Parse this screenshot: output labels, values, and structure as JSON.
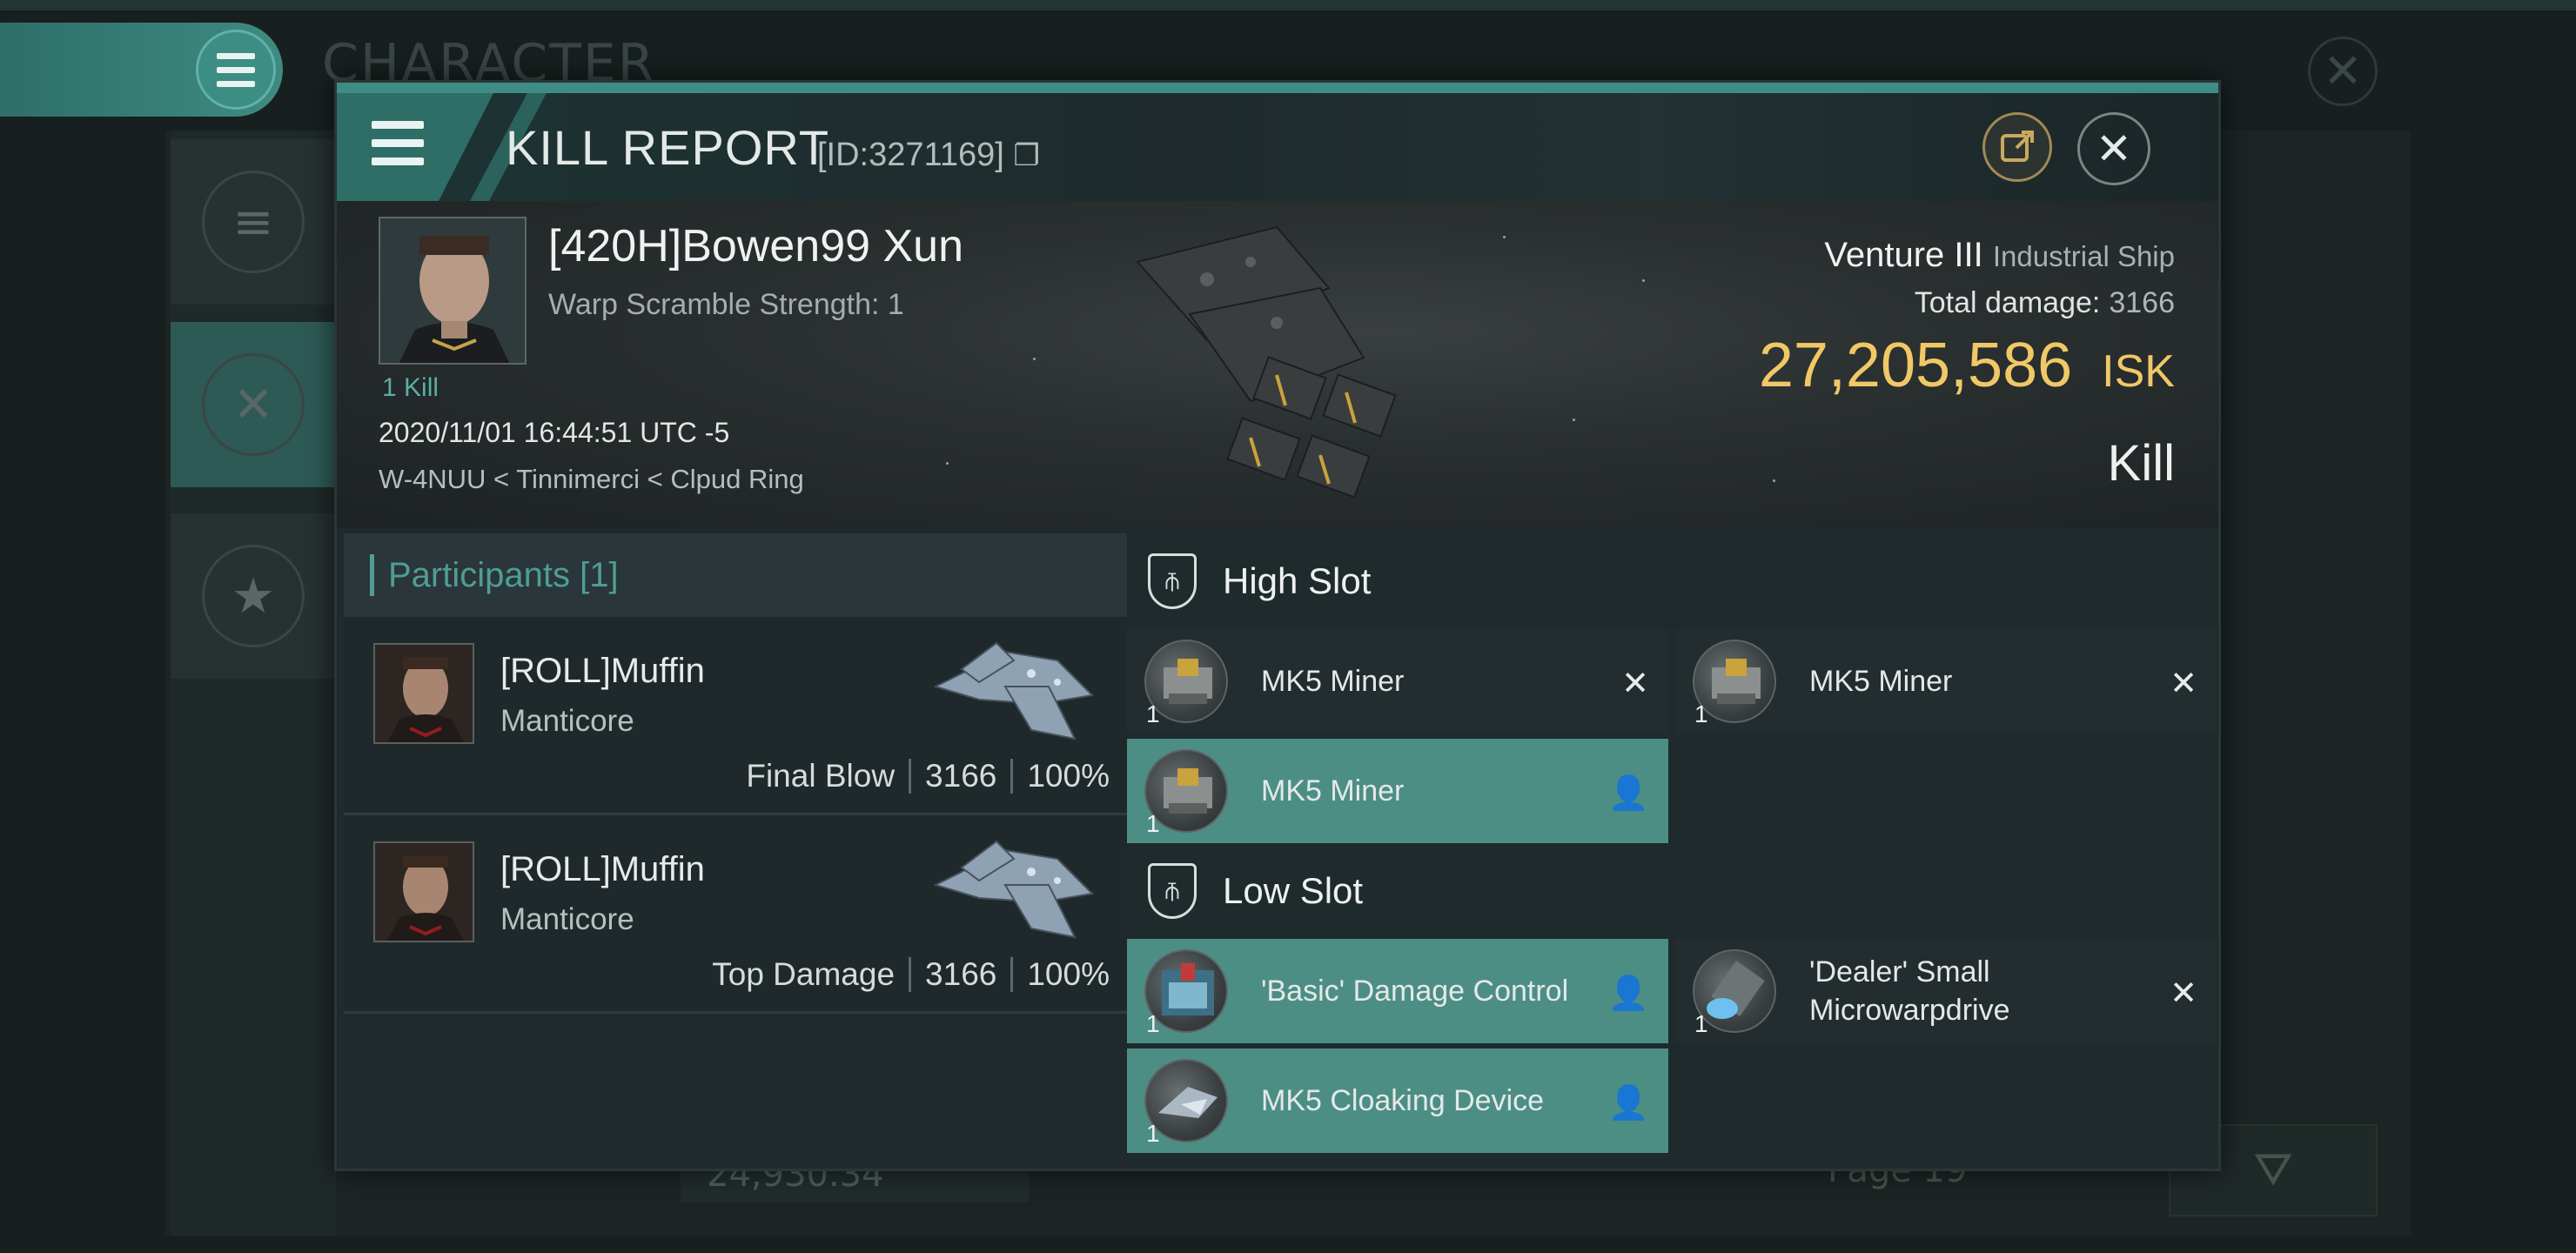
{
  "background": {
    "title": "CHARACTER",
    "value_text": "24,930.34",
    "page_label": "Page 19"
  },
  "modal": {
    "title": "KILL REPORT",
    "id_label": "[ID:3271169]",
    "victim": {
      "name": "[420H]Bowen99 Xun",
      "warp_scramble": "Warp Scramble Strength: 1",
      "kills": "1 Kill",
      "datetime": "2020/11/01 16:44:51 UTC -5",
      "location": "W-4NUU < Tinnimerci < Clpud Ring",
      "ship_name": "Venture III",
      "ship_class": "Industrial Ship",
      "total_damage_label": "Total damage:",
      "total_damage": "3166",
      "isk_value": "27,205,586",
      "isk_unit": "ISK",
      "kill_type": "Kill"
    },
    "participants": {
      "header": "Participants [1]",
      "rows": [
        {
          "name": "[ROLL]Muffin",
          "ship": "Manticore",
          "role": "Final Blow",
          "damage": "3166",
          "percent": "100%"
        },
        {
          "name": "[ROLL]Muffin",
          "ship": "Manticore",
          "role": "Top Damage",
          "damage": "3166",
          "percent": "100%"
        }
      ]
    },
    "fitting": {
      "high_slot_label": "High Slot",
      "low_slot_label": "Low Slot",
      "high": [
        {
          "name": "MK5 Miner",
          "qty": "1",
          "status": "destroyed",
          "mark": "✕"
        },
        {
          "name": "MK5 Miner",
          "qty": "1",
          "status": "destroyed",
          "mark": "✕"
        },
        {
          "name": "MK5 Miner",
          "qty": "1",
          "status": "dropped",
          "mark": "👤"
        }
      ],
      "low": [
        {
          "name": "'Basic' Damage Control",
          "qty": "1",
          "status": "dropped",
          "mark": "👤"
        },
        {
          "name": "'Dealer' Small Microwarpdrive",
          "qty": "1",
          "status": "destroyed",
          "mark": "✕"
        },
        {
          "name": "MK5 Cloaking Device",
          "qty": "1",
          "status": "dropped",
          "mark": "👤"
        }
      ]
    }
  },
  "colors": {
    "accent": "#4c8e84",
    "isk": "#f0c866",
    "participants_header": "#4f9d93"
  }
}
